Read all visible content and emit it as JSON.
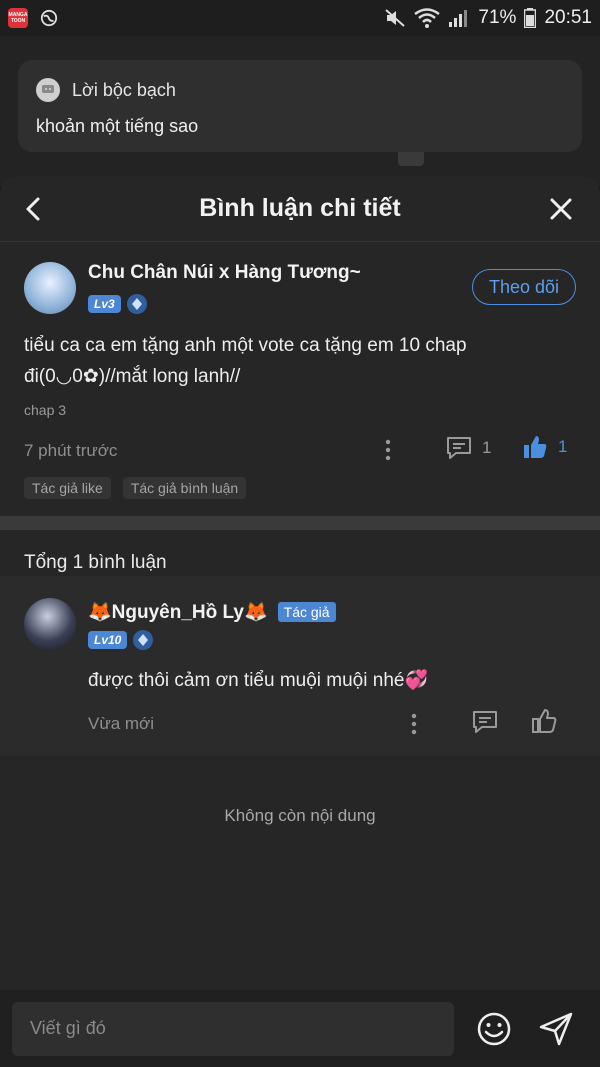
{
  "statusbar": {
    "app_icon_text": "MANGA TOON",
    "battery": "71%",
    "time": "20:51",
    "icons": [
      "mute-icon",
      "wifi-icon",
      "signal-icon",
      "battery-icon"
    ]
  },
  "notification": {
    "app_name": "Lời bộc bạch",
    "message": "khoản một tiếng sao"
  },
  "sheet": {
    "title": "Bình luận chi tiết"
  },
  "comment": {
    "username": "Chu Chân Núi x Hàng Tương~",
    "level": "Lv3",
    "follow_label": "Theo dõi",
    "text": "tiểu ca ca em tặng anh một vote ca tặng em 10 chap đi(0◡0✿)//mắt long lanh//",
    "chapter": "chap 3",
    "time": "7 phút trước",
    "reply_count": "1",
    "like_count": "1",
    "tags": [
      "Tác giả like",
      "Tác giả bình luận"
    ]
  },
  "total_label": "Tổng 1 bình luận",
  "reply": {
    "username": "🦊Nguyên_Hồ Ly🦊",
    "author_badge": "Tác giả",
    "level": "Lv10",
    "text": "được thôi cảm ơn tiểu muội muội nhé💞",
    "time": "Vừa mới"
  },
  "no_more": "Không còn nội dung",
  "input": {
    "placeholder": "Viết gì đó"
  },
  "colors": {
    "accent": "#4a8fe0",
    "background": "#262626"
  }
}
